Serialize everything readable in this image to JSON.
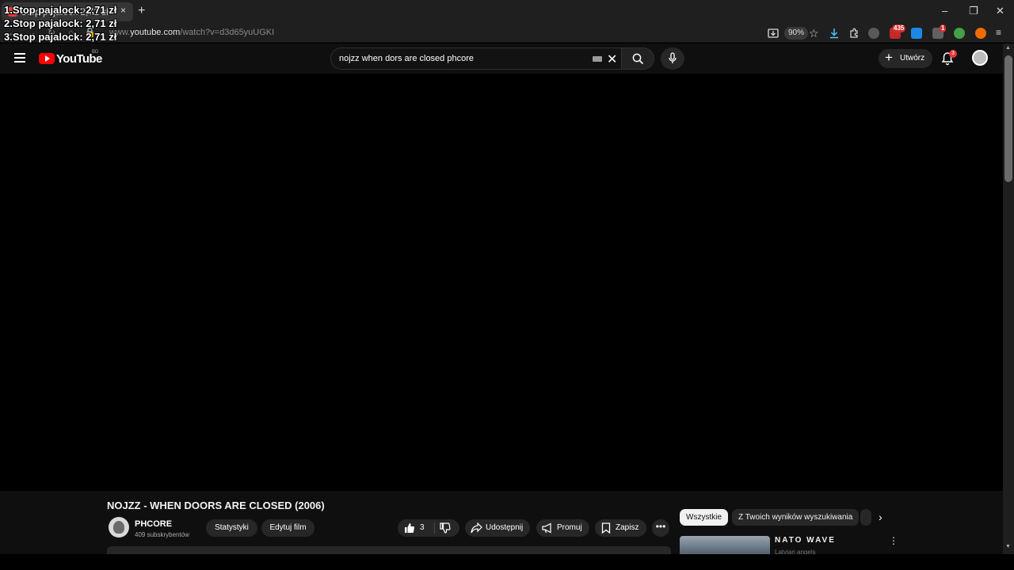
{
  "overlay": {
    "lines": [
      "1.Stop pajalock: 2,71 zł",
      "2.Stop pajalock: 2,71 zł",
      "3.Stop pajalock: 2,71 zł"
    ]
  },
  "browser": {
    "tab_title": "Stop pajalock 2,71 zł",
    "tab_close": "×",
    "new_tab": "+",
    "window_controls": [
      "–",
      "❐",
      "✕"
    ],
    "url_prefix": "www.",
    "url_host": "youtube.com",
    "url_path": "/watch?v=d3d65yuUGKI",
    "zoom": "90%",
    "extension_badge_count": "435",
    "extension_badge_small": "1"
  },
  "youtube": {
    "logo_text": "YouTube",
    "country_code": "BD",
    "search_value": "nojzz when dors are closed phcore",
    "create_label": "Utwórz",
    "notification_count": "3"
  },
  "video": {
    "title": "NOJZZ - WHEN DOORS ARE CLOSED (2006)",
    "channel_name": "PHCORE",
    "subscribers": "409 subskrybentów",
    "stats_label": "Statystyki",
    "edit_label": "Edytuj film",
    "like_count": "3",
    "share_label": "Udostępnij",
    "promote_label": "Promuj",
    "save_label": "Zapisz",
    "more": "•••"
  },
  "recommendations": {
    "chips": [
      "Wszystkie",
      "Z Twoich wyników wyszukiwania"
    ],
    "items": [
      {
        "title": "NATO WAVE",
        "subtitle": "Latvian angels"
      }
    ]
  },
  "colors": {
    "youtube_red": "#ff0000",
    "background": "#0f0f0f",
    "pill": "#272727"
  }
}
